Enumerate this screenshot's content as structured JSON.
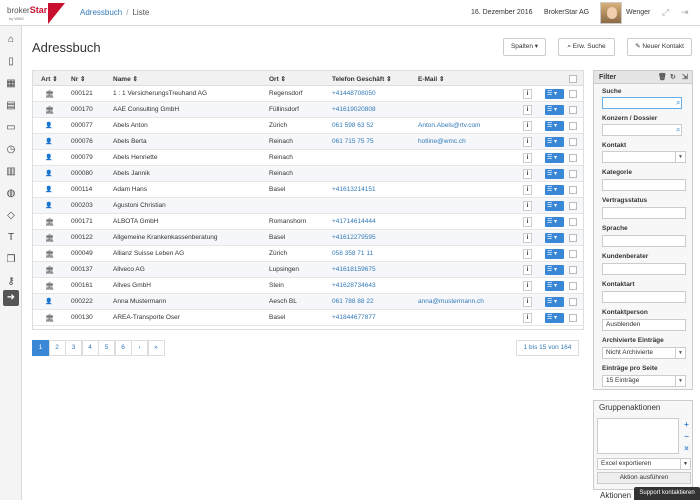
{
  "header": {
    "logo_text_a": "broker",
    "logo_text_b": "Star",
    "logo_sub": "by WMC",
    "breadcrumb_1": "Adressbuch",
    "breadcrumb_sep": "/",
    "breadcrumb_2": "Liste",
    "date": "16. Dezember 2016",
    "company": "BrokerStar AG",
    "user": "Wenger",
    "brand_color": "#c8102e"
  },
  "leftnav": [
    "home-icon",
    "book-icon",
    "calendar-icon",
    "calendar-alt-icon",
    "document-icon",
    "clock-icon",
    "table-icon",
    "globe-icon",
    "tag-icon",
    "text-icon",
    "copy-icon",
    "key-icon",
    "arrow-right-circle-icon"
  ],
  "page": {
    "title": "Adressbuch",
    "btn_spalten": "Spalten ▾",
    "btn_erw_suche": "Erw. Suche",
    "btn_neuer_kontakt": "Neuer Kontakt"
  },
  "table": {
    "headers": {
      "art": "Art",
      "nr": "Nr",
      "name": "Name",
      "ort": "Ort",
      "telefon": "Telefon Geschäft",
      "email": "E-Mail"
    },
    "rows": [
      {
        "type": "company",
        "nr": "000121",
        "name": "1 : 1 VersicherungsTreuhand AG",
        "ort": "Regensdorf",
        "tel": "+41448708050",
        "email": ""
      },
      {
        "type": "company",
        "nr": "000170",
        "name": "AAE Consulting GmbH",
        "ort": "Füllinsdorf",
        "tel": "+41619020808",
        "email": ""
      },
      {
        "type": "person",
        "nr": "000077",
        "name": "Abels Anton",
        "ort": "Zürich",
        "tel": "061 598 63 52",
        "email": "Anton.Abels@rtv.com"
      },
      {
        "type": "person",
        "nr": "000076",
        "name": "Abels Berta",
        "ort": "Reinach",
        "tel": "061 715 75 75",
        "email": "hotline@wmc.ch"
      },
      {
        "type": "person",
        "nr": "000079",
        "name": "Abels Henriette",
        "ort": "Reinach",
        "tel": "",
        "email": ""
      },
      {
        "type": "person",
        "nr": "000080",
        "name": "Abels Jannik",
        "ort": "Reinach",
        "tel": "",
        "email": ""
      },
      {
        "type": "person",
        "nr": "000114",
        "name": "Adam Hans",
        "ort": "Basel",
        "tel": "+41613214151",
        "email": ""
      },
      {
        "type": "person",
        "nr": "000203",
        "name": "Agustoni Christian",
        "ort": "",
        "tel": "",
        "email": ""
      },
      {
        "type": "company",
        "nr": "000171",
        "name": "ALBOTA GmbH",
        "ort": "Romanshorn",
        "tel": "+41714614444",
        "email": ""
      },
      {
        "type": "company",
        "nr": "000122",
        "name": "Allgemeine Krankenkassenberatung",
        "ort": "Basel",
        "tel": "+41612279595",
        "email": ""
      },
      {
        "type": "company",
        "nr": "000049",
        "name": "Allianz Suisse Leben AG",
        "ort": "Zürich",
        "tel": "058 358 71 11",
        "email": ""
      },
      {
        "type": "company",
        "nr": "000137",
        "name": "Allveco AG",
        "ort": "Lupsingen",
        "tel": "+41618159675",
        "email": ""
      },
      {
        "type": "company",
        "nr": "000161",
        "name": "Allves GmbH",
        "ort": "Stein",
        "tel": "+41628734643",
        "email": ""
      },
      {
        "type": "person",
        "nr": "000222",
        "name": "Anna Mustermann",
        "ort": "Aesch BL",
        "tel": "061 788 88 22",
        "email": "anna@mustermann.ch"
      },
      {
        "type": "company",
        "nr": "000130",
        "name": "AREA-Transporte Oser",
        "ort": "Basel",
        "tel": "+41844677877",
        "email": ""
      }
    ],
    "info_label": "i",
    "action_label": "☰ ▾"
  },
  "pager": {
    "pages": [
      "1",
      "2",
      "3",
      "4",
      "5",
      "6",
      "›",
      "»"
    ],
    "info": "1 bis 15 von 164"
  },
  "filter": {
    "title": "Filter",
    "suche": "Suche",
    "konzern": "Konzern / Dossier",
    "kontakt": "Kontakt",
    "kategorie": "Kategorie",
    "vertragsstatus": "Vertragsstatus",
    "sprache": "Sprache",
    "kundenberater": "Kundenberater",
    "kontaktart": "Kontaktart",
    "kontaktperson": "Kontaktperson",
    "kontaktperson_value": "Ausblenden",
    "archiviert": "Archivierte Einträge",
    "archiviert_value": "Nicht Archivierte",
    "eintraege": "Einträge pro Seite",
    "eintraege_value": "15 Einträge"
  },
  "gruppe": {
    "title": "Gruppenaktionen",
    "excel": "Excel exportieren",
    "ausfuehren": "Aktion ausführen",
    "aktionen": "Aktionen",
    "support": "Support kontaktieren"
  }
}
